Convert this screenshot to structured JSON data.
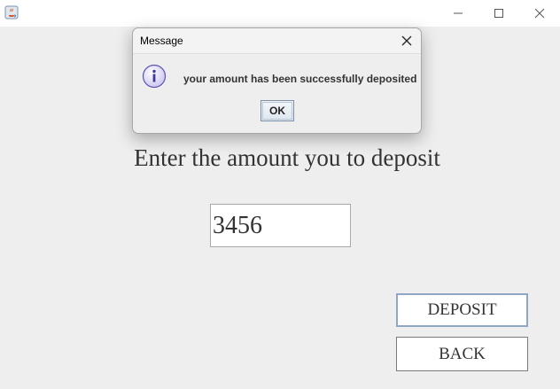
{
  "window": {
    "app_icon": "java-cup-icon",
    "controls": [
      "minimize-icon",
      "maximize-icon",
      "close-icon"
    ]
  },
  "main": {
    "prompt": "Enter the amount you to deposit",
    "amount_value": "3456",
    "deposit_label": "DEPOSIT",
    "back_label": "BACK"
  },
  "dialog": {
    "title": "Message",
    "icon": "info-icon",
    "message": "your amount has been successfully deposited",
    "ok_label": "OK"
  }
}
